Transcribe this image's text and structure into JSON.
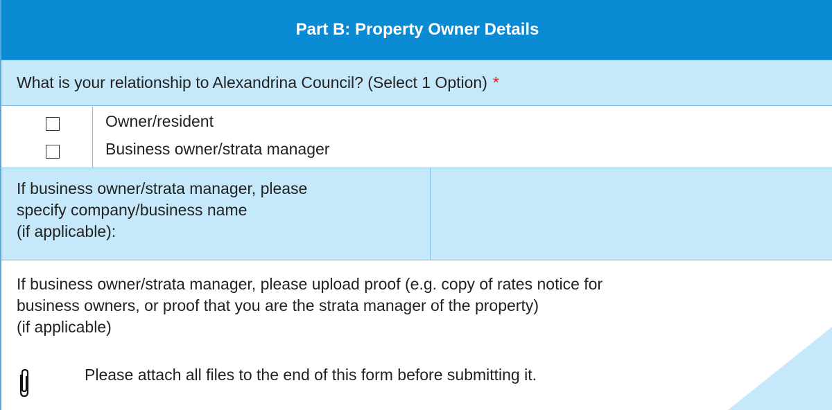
{
  "header": {
    "title": "Part B: Property Owner Details"
  },
  "question": {
    "text": "What is your relationship to Alexandrina Council? (Select 1 Option)",
    "required_mark": "*"
  },
  "options": [
    {
      "label": "Owner/resident",
      "checked": false
    },
    {
      "label": "Business owner/strata manager",
      "checked": false
    }
  ],
  "company": {
    "label_line1": "If business owner/strata manager, please",
    "label_line2": "specify company/business name",
    "label_line3": "(if applicable):",
    "value": ""
  },
  "upload": {
    "line1": "If business owner/strata manager, please upload proof (e.g. copy of rates notice for",
    "line2": "business owners, or proof that you are the strata manager of the property)",
    "line3": "(if applicable)",
    "note": "Please attach all files to the end of this form before submitting it."
  },
  "colors": {
    "header_bg": "#0a8ad3",
    "row_bg": "#c6e8fb",
    "required": "#e0231e"
  },
  "icons": {
    "attachment": "paperclip-icon"
  }
}
